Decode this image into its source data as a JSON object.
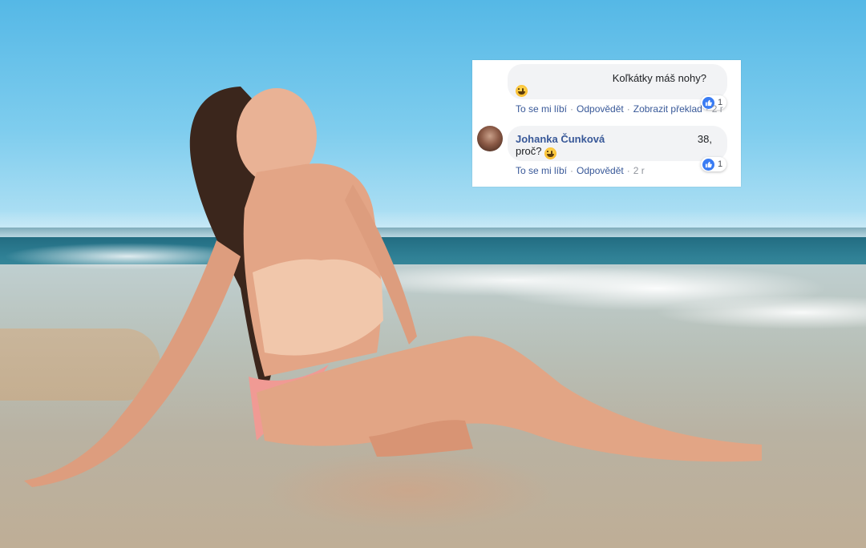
{
  "comments": [
    {
      "text": "Koľkátky máš nohy?",
      "actions": {
        "like": "To se mi líbí",
        "reply": "Odpovědět",
        "translate": "Zobrazit překlad",
        "time": "2 r"
      },
      "reaction_count": "1",
      "emoji": "grinning-emoji"
    },
    {
      "author": "Johanka Čunková",
      "age": "38,",
      "text": "proč?",
      "actions": {
        "like": "To se mi líbí",
        "reply": "Odpovědět",
        "time": "2 r"
      },
      "reaction_count": "1",
      "emoji": "grinning-emoji"
    }
  ],
  "colors": {
    "link": "#385898",
    "like_blue": "#3a7cf3",
    "bubble": "#f2f3f5"
  }
}
